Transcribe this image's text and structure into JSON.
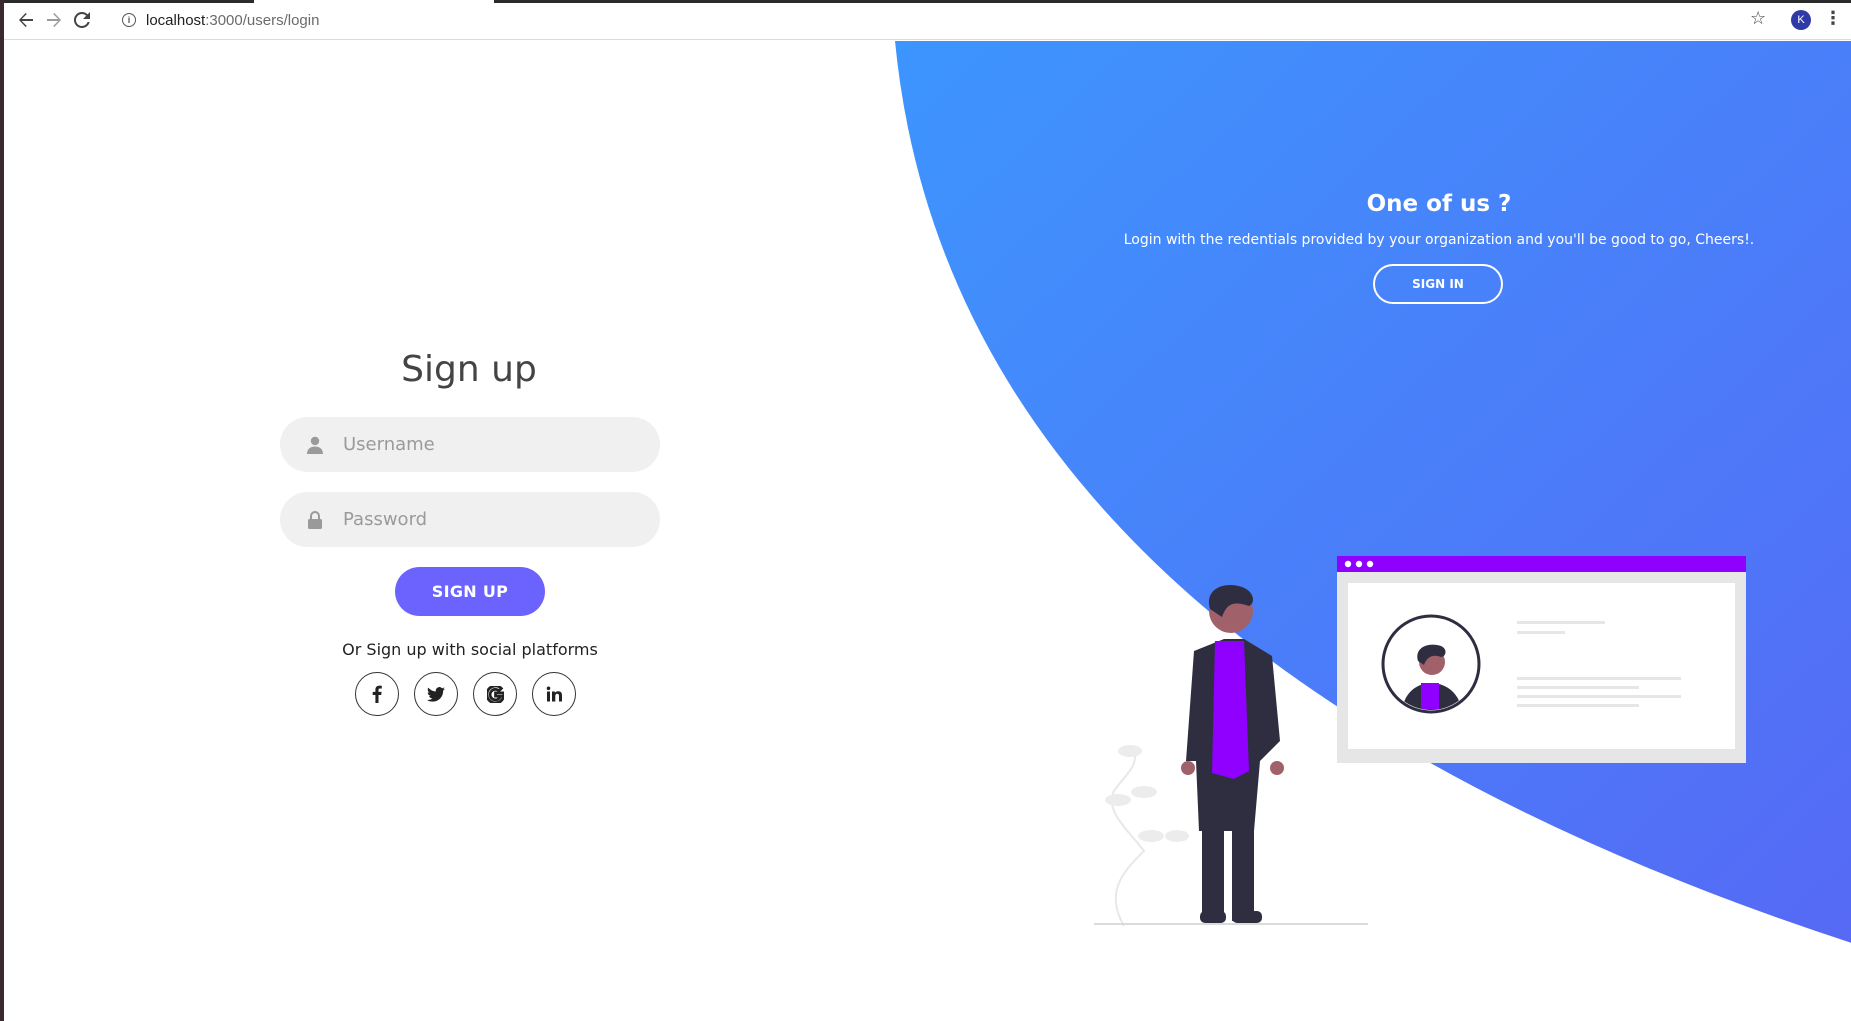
{
  "browser": {
    "url_host": "localhost",
    "url_path": ":3000/users/login",
    "profile_initial": "K"
  },
  "signup": {
    "title": "Sign up",
    "username_placeholder": "Username",
    "password_placeholder": "Password",
    "button_label": "SIGN UP",
    "social_text": "Or Sign up with social platforms",
    "social": [
      {
        "name": "facebook",
        "glyph": "f"
      },
      {
        "name": "twitter",
        "glyph": "twitter"
      },
      {
        "name": "google",
        "glyph": "G"
      },
      {
        "name": "linkedin",
        "glyph": "in"
      }
    ]
  },
  "panel": {
    "title": "One of us ?",
    "text": "Login with the redentials provided by your organization and you'll be good to go, Cheers!.",
    "button_label": "SIGN IN"
  },
  "colors": {
    "accent": "#6c63ff",
    "gradient_start": "#3d95fe",
    "gradient_end": "#5669f5",
    "illustration_purple": "#8f00ff"
  }
}
